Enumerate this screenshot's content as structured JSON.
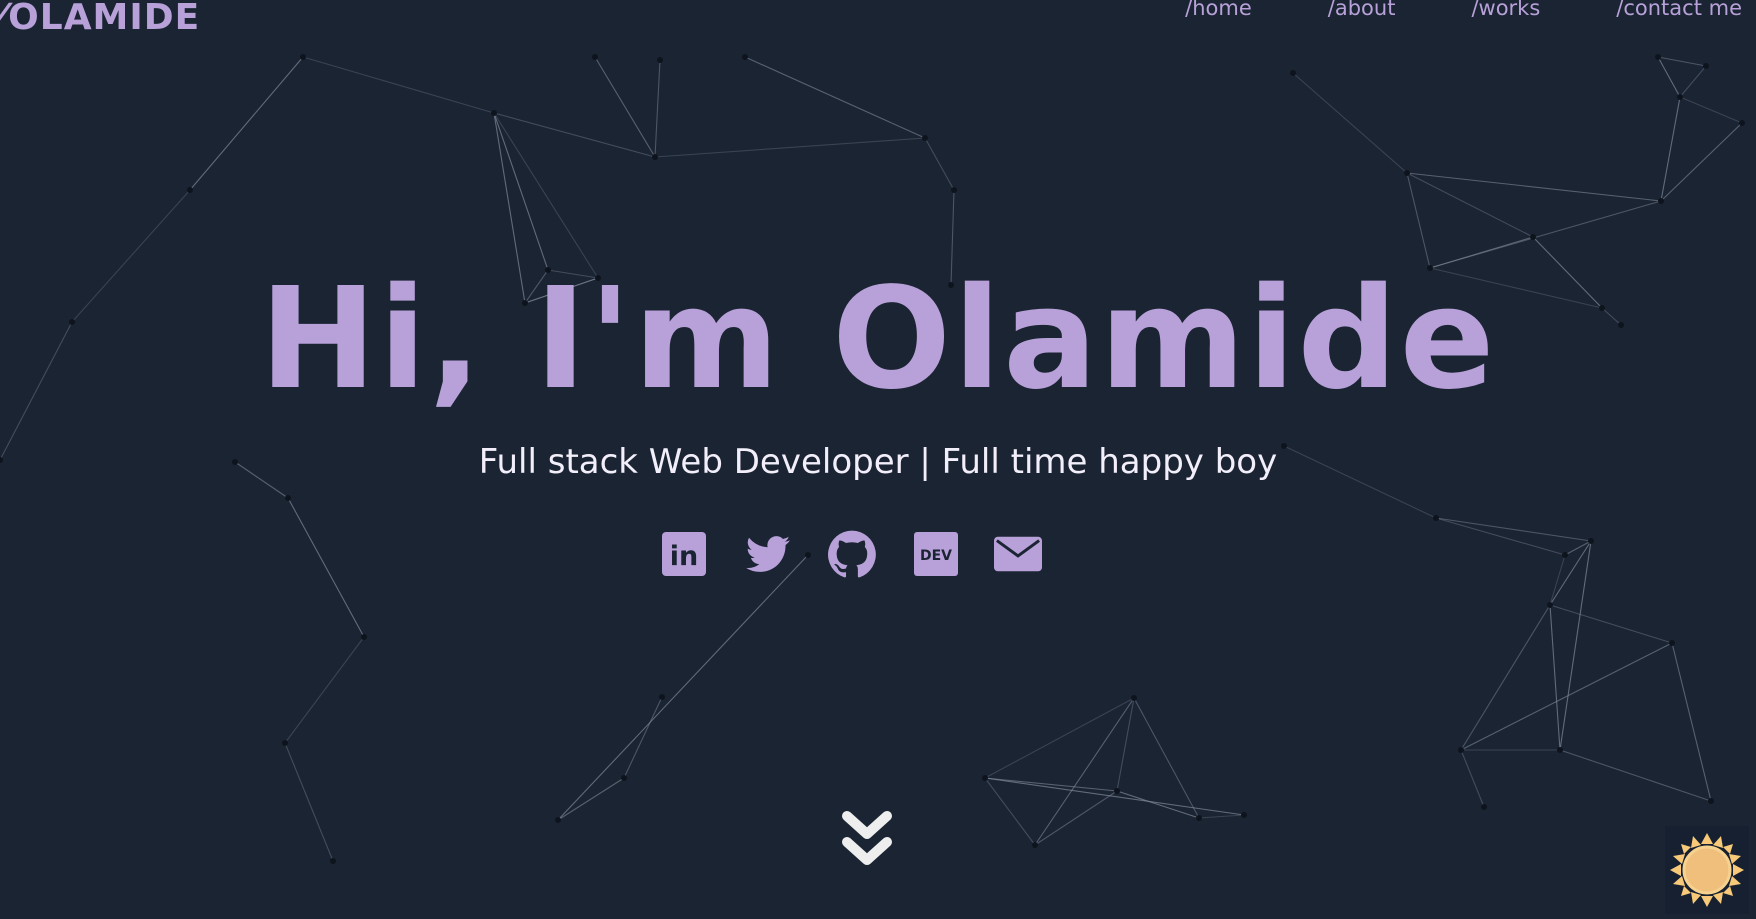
{
  "header": {
    "logo_slash": "/",
    "logo_text": "OLAMIDE",
    "nav": [
      {
        "label": "/home"
      },
      {
        "label": "/about"
      },
      {
        "label": "/works"
      },
      {
        "label": "/contact me"
      }
    ]
  },
  "hero": {
    "title": "Hi, I'm Olamide",
    "subtitle": "Full stack Web Developer | Full time happy boy"
  },
  "socials": [
    {
      "icon": "linkedin-icon",
      "text": "in"
    },
    {
      "icon": "twitter-icon"
    },
    {
      "icon": "github-icon"
    },
    {
      "icon": "dev-icon",
      "text": "DEV"
    },
    {
      "icon": "mail-icon"
    }
  ],
  "colors": {
    "background": "#1b2433",
    "accent": "#b7a1d8",
    "text": "#f2eefa",
    "sun": "#f7c978"
  },
  "icons": {
    "scroll": "chevron-double-down-icon",
    "theme": "sun-icon"
  }
}
